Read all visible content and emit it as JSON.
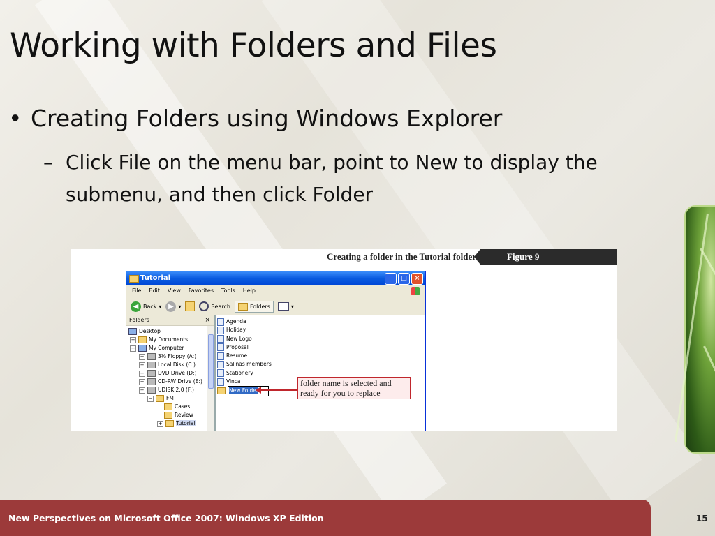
{
  "slide": {
    "title": "Working with Folders and Files",
    "bullet_level1": "Creating Folders using Windows Explorer",
    "bullet_level2_dash": "–",
    "bullet_level2": "Click File on the menu bar, point to New to display the submenu, and then click Folder",
    "footer": "New Perspectives on Microsoft Office 2007: Windows XP Edition",
    "page_number": "15"
  },
  "figure": {
    "caption": "Creating a folder in the Tutorial folder",
    "label": "Figure  9",
    "callout": "folder name is selected and ready for you to replace"
  },
  "window": {
    "title": "Tutorial",
    "menu": [
      "File",
      "Edit",
      "View",
      "Favorites",
      "Tools",
      "Help"
    ],
    "toolbar": {
      "back": "Back",
      "search": "Search",
      "folders": "Folders"
    },
    "folders_pane_title": "Folders",
    "folders_pane_close": "×",
    "tree": [
      {
        "label": "Desktop",
        "expander": ""
      },
      {
        "label": "My Documents",
        "expander": "+"
      },
      {
        "label": "My Computer",
        "expander": "−"
      },
      {
        "label": "3½ Floppy (A:)",
        "expander": "+"
      },
      {
        "label": "Local Disk (C:)",
        "expander": "+"
      },
      {
        "label": "DVD Drive (D:)",
        "expander": "+"
      },
      {
        "label": "CD-RW Drive (E:)",
        "expander": "+"
      },
      {
        "label": "UDISK 2.0 (F:)",
        "expander": "−"
      },
      {
        "label": "FM",
        "expander": "−"
      },
      {
        "label": "Cases",
        "expander": ""
      },
      {
        "label": "Review",
        "expander": ""
      },
      {
        "label": "Tutorial",
        "expander": "+"
      }
    ],
    "files": [
      "Agenda",
      "Holiday",
      "New Logo",
      "Proposal",
      "Resume",
      "Salinas members",
      "Stationery",
      "Vinca"
    ],
    "new_folder": "New Folder"
  },
  "colors": {
    "footer_bg": "#9c3a3a",
    "callout_border": "#c0272d",
    "xp_title_blue": "#0a5be0"
  }
}
